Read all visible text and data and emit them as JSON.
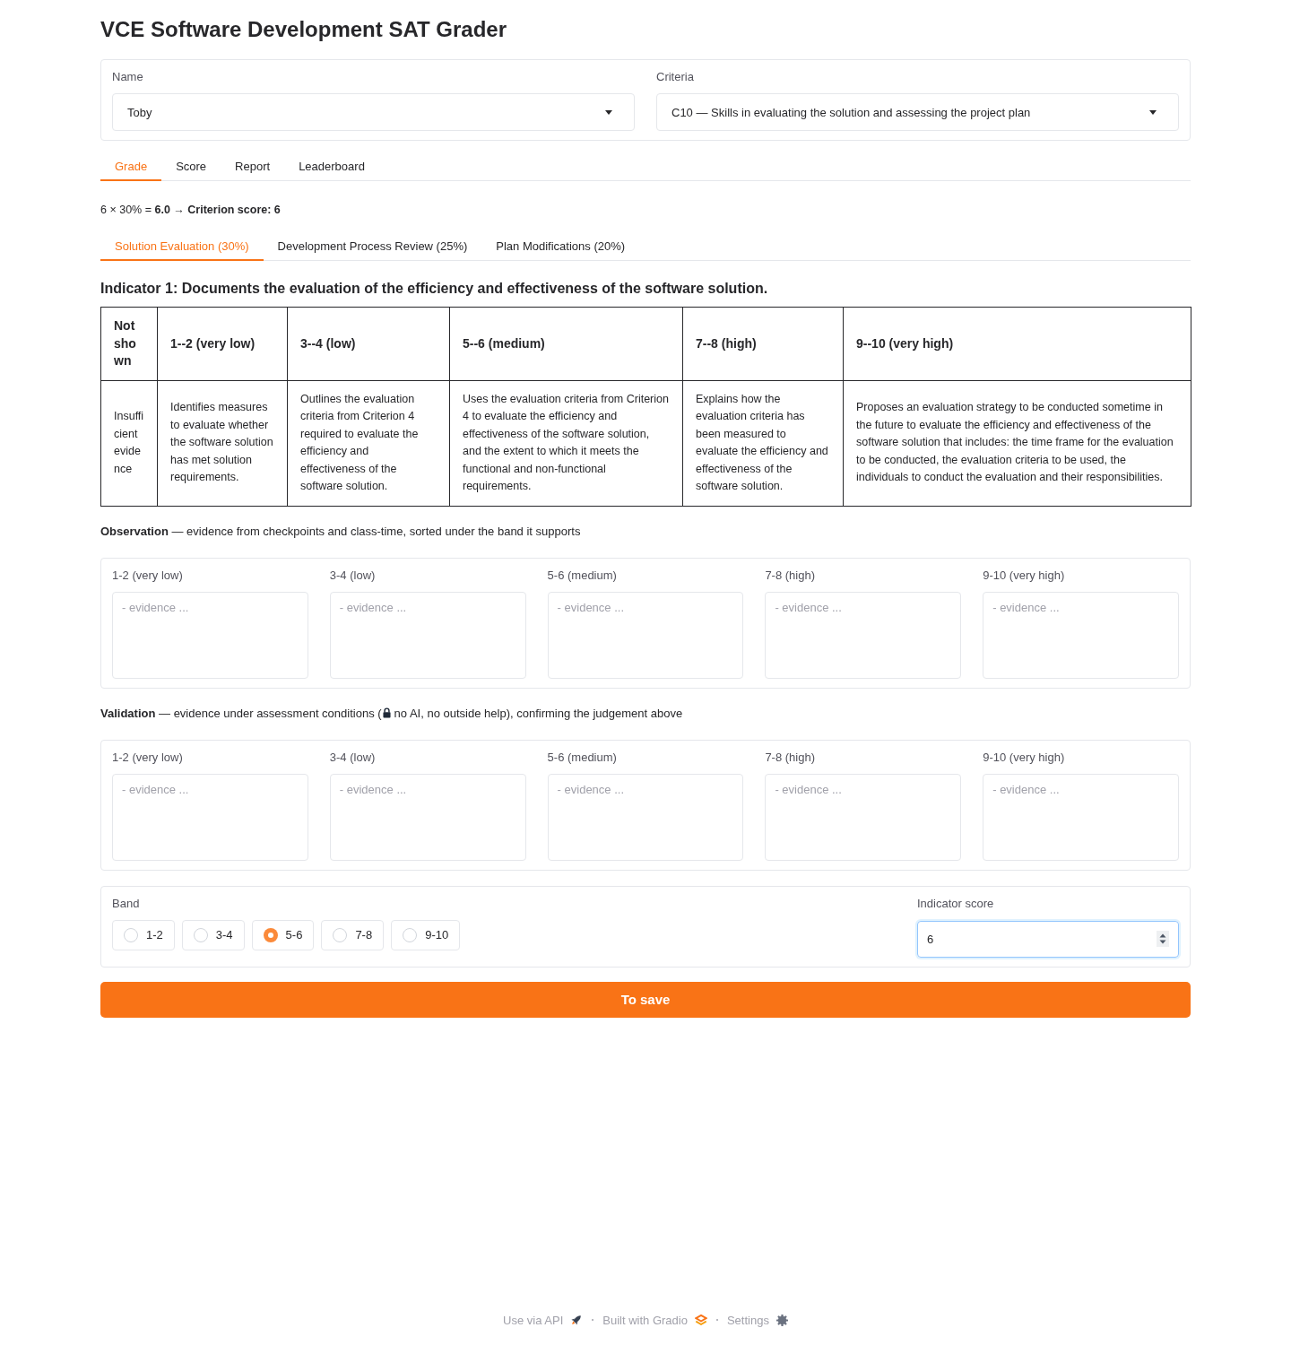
{
  "title": "VCE Software Development SAT Grader",
  "selectors": [
    {
      "label": "Name",
      "value": "Toby"
    },
    {
      "label": "Criteria",
      "value": "C10 — Skills in evaluating the solution and assessing the project plan"
    }
  ],
  "tabs": [
    {
      "label": "Grade",
      "selected": true
    },
    {
      "label": "Score",
      "selected": false
    },
    {
      "label": "Report",
      "selected": false
    },
    {
      "label": "Leaderboard",
      "selected": false
    }
  ],
  "summary": "6 × 30% = **6.0** → **Criterion score: 6**",
  "indicator_tabs": [
    {
      "label": "Solution Evaluation (30%)",
      "selected": true
    },
    {
      "label": "Development Process Review (25%)",
      "selected": false
    },
    {
      "label": "Plan Modifications (20%)",
      "selected": false
    }
  ],
  "indicator": {
    "heading": "Indicator 1: Documents the evaluation of the efficiency and effectiveness of the software solution.",
    "rubric": {
      "columns": [
        "Not shown",
        "1--2 (very low)",
        "3--4 (low)",
        "5--6 (medium)",
        "7--8 (high)",
        "9--10 (very high)"
      ],
      "descriptors": [
        "Insufficient evidence",
        "Identifies measures to evaluate whether the software solution has met solution requirements.",
        "Outlines the evaluation criteria from Criterion 4 required to evaluate the efficiency and effectiveness of the software solution.",
        "Uses the evaluation criteria from Criterion 4 to evaluate the efficiency and effectiveness of the software solution, and the extent to which it meets the functional and non-functional requirements.",
        "Explains how the evaluation criteria has been measured to evaluate the efficiency and effectiveness of the software solution.",
        "Proposes an evaluation strategy to be conducted sometime in the future to evaluate the efficiency and effectiveness of the software solution that includes: the time frame for the evaluation to be conducted, the evaluation criteria to be used, the individuals to conduct the evaluation and their responsibilities."
      ]
    }
  },
  "observation": {
    "text": "**Observation** — evidence from checkpoints and class-time, sorted under the band it supports",
    "fields": [
      {
        "label": "1-2 (very low)",
        "placeholder": "- evidence ..."
      },
      {
        "label": "3-4 (low)",
        "placeholder": "- evidence ..."
      },
      {
        "label": "5-6 (medium)",
        "placeholder": "- evidence ..."
      },
      {
        "label": "7-8 (high)",
        "placeholder": "- evidence ..."
      },
      {
        "label": "9-10 (very high)",
        "placeholder": "- evidence ..."
      }
    ]
  },
  "validation": {
    "text_before_icon": "**Validation** — evidence under assessment conditions (",
    "text_after_icon": "no AI, no outside help), confirming the judgement above",
    "fields": [
      {
        "label": "1-2 (very low)",
        "placeholder": "- evidence ..."
      },
      {
        "label": "3-4 (low)",
        "placeholder": "- evidence ..."
      },
      {
        "label": "5-6 (medium)",
        "placeholder": "- evidence ..."
      },
      {
        "label": "7-8 (high)",
        "placeholder": "- evidence ..."
      },
      {
        "label": "9-10 (very high)",
        "placeholder": "- evidence ..."
      }
    ]
  },
  "band": {
    "label": "Band",
    "options": [
      {
        "label": "1-2",
        "selected": false
      },
      {
        "label": "3-4",
        "selected": false
      },
      {
        "label": "5-6",
        "selected": true
      },
      {
        "label": "7-8",
        "selected": false
      },
      {
        "label": "9-10",
        "selected": false
      }
    ]
  },
  "indicator_score": {
    "label": "Indicator score",
    "value": "6",
    "focused": true
  },
  "save_button": "To save",
  "footer": [
    {
      "label": "Use via API",
      "kind": "api"
    },
    {
      "label": "Built with Gradio",
      "kind": "brand"
    },
    {
      "label": "Settings",
      "kind": "settings"
    }
  ]
}
